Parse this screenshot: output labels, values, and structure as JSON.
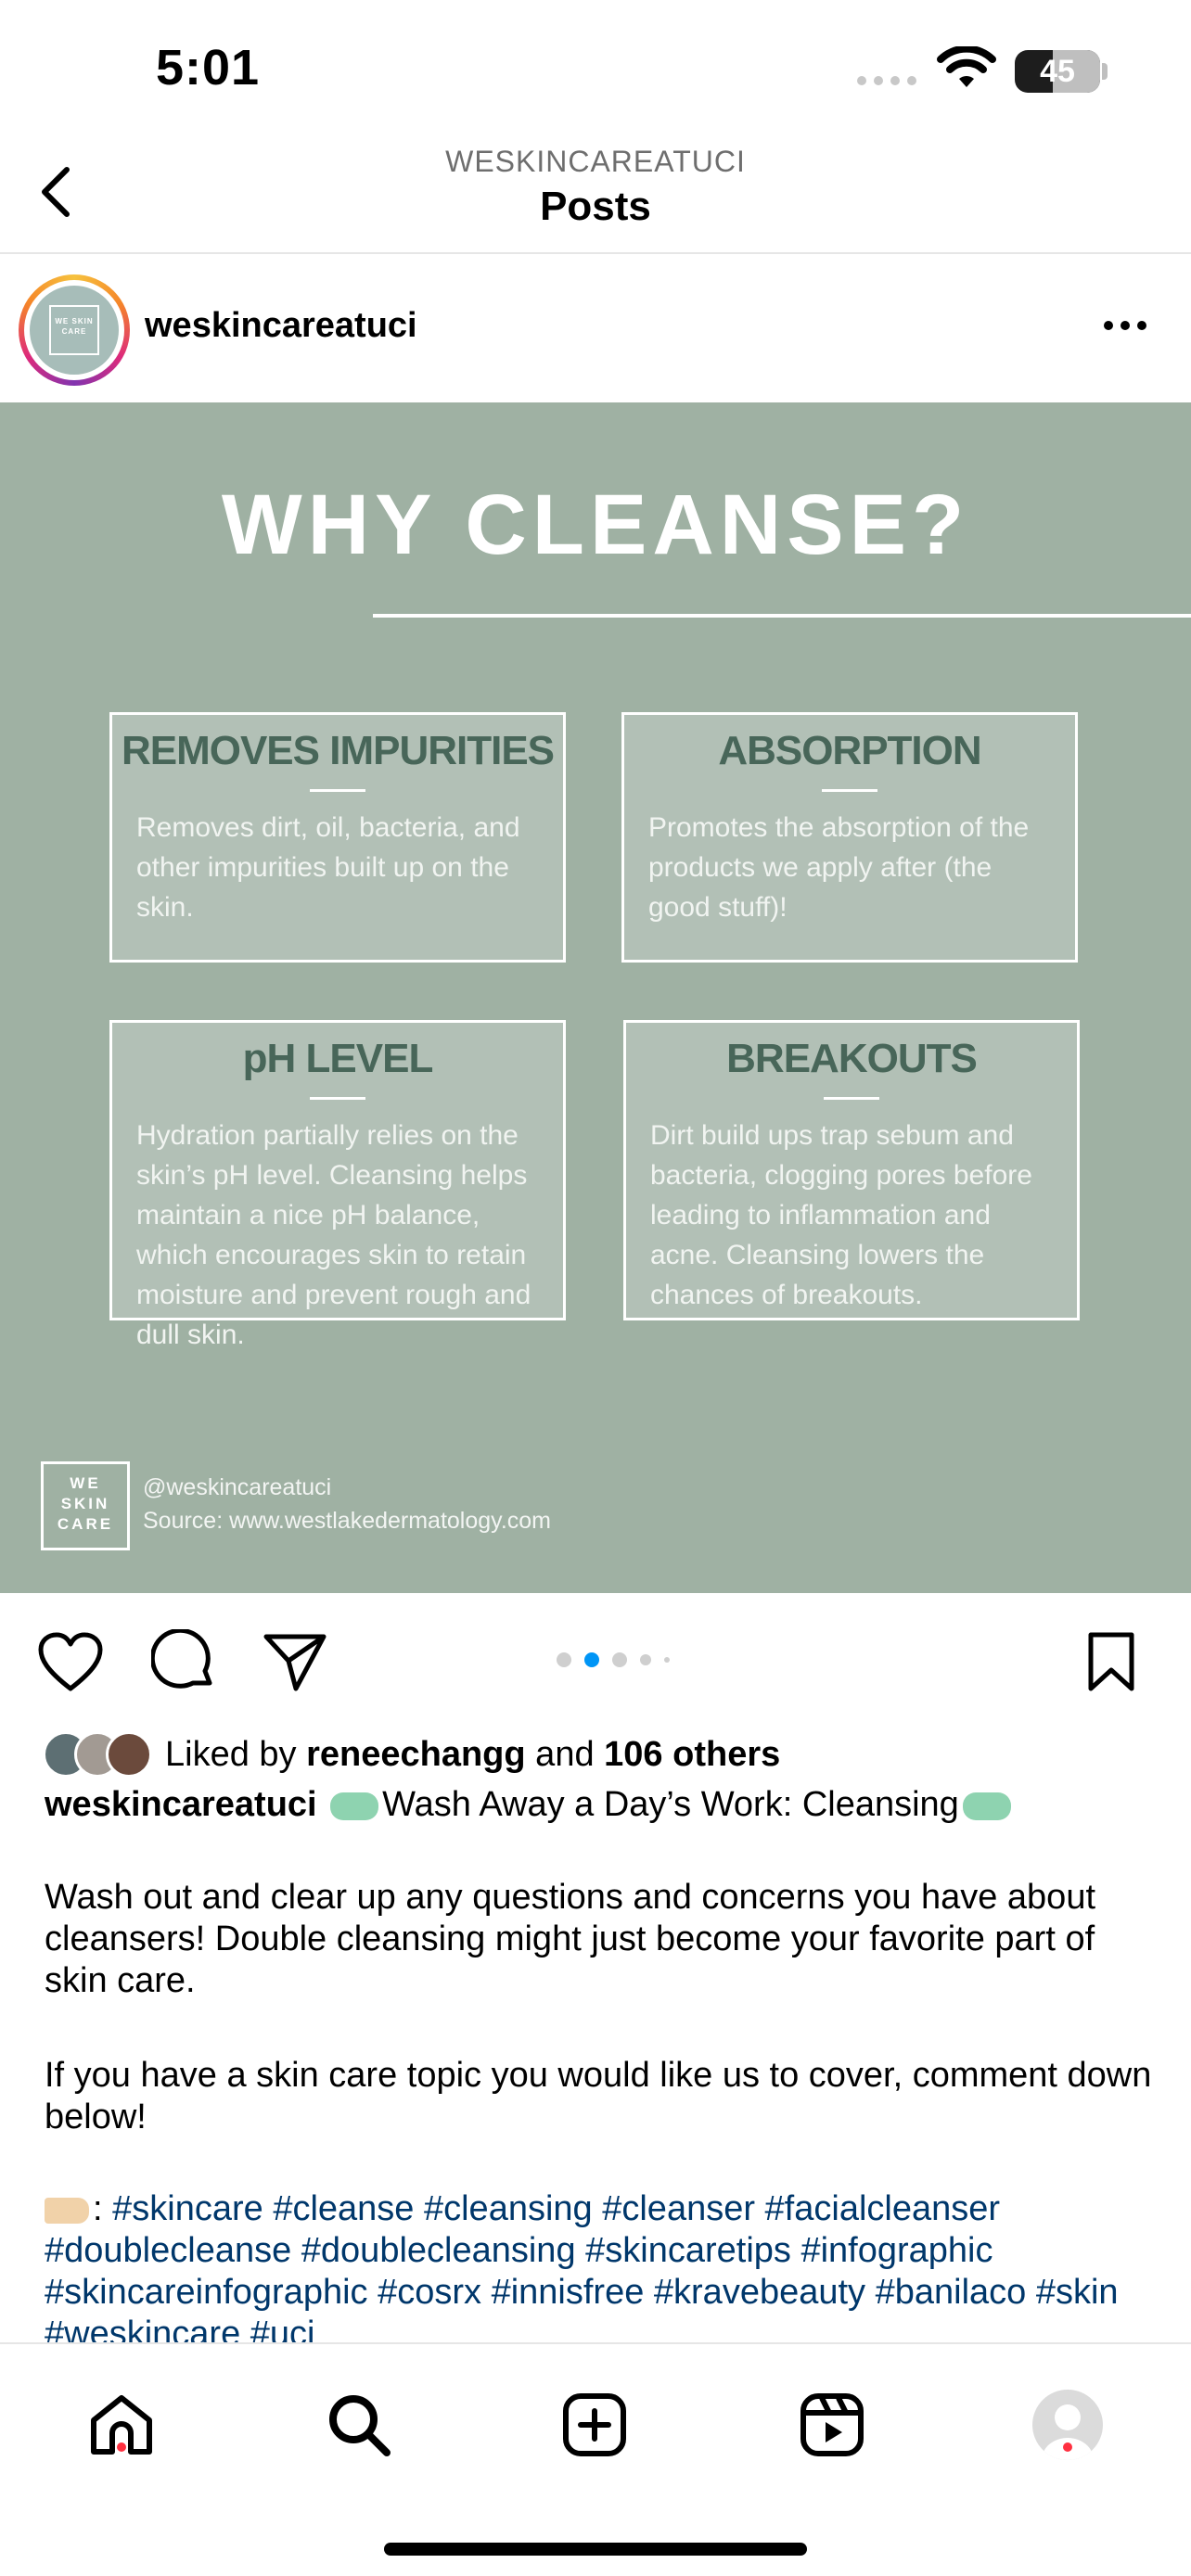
{
  "status_bar": {
    "time": "5:01",
    "battery": "45",
    "battery_level": 0.45
  },
  "nav": {
    "subtitle": "WESKINCAREATUCI",
    "title": "Posts"
  },
  "post": {
    "username": "weskincareatuci",
    "avatar_logo": "WE SKIN CARE"
  },
  "infographic": {
    "title": "WHY CLEANSE?",
    "cards": [
      {
        "heading": "REMOVES IMPURITIES",
        "body": "Removes dirt, oil, bacteria, and other impurities built up on the skin."
      },
      {
        "heading": "ABSORPTION",
        "body": "Promotes the absorption of the products we apply after (the good stuff)!"
      },
      {
        "heading": "pH LEVEL",
        "body": "Hydration partially relies on the skin’s pH level. Cleansing helps maintain a nice pH balance, which encourages skin to retain moisture and prevent rough and dull skin."
      },
      {
        "heading": "BREAKOUTS",
        "body": "Dirt build ups trap sebum and bacteria, clogging pores before leading to inflammation and acne. Cleansing lowers the chances of breakouts."
      }
    ],
    "footer_logo": [
      "WE",
      "SKIN",
      "CARE"
    ],
    "footer_handle": "@weskincareatuci",
    "footer_source": "Source: www.westlakedermatology.com"
  },
  "carousel": {
    "active_index": 1,
    "count": 5
  },
  "likes": {
    "prefix": "Liked by ",
    "user": "reneechangg",
    "middle": " and ",
    "others": "106 others"
  },
  "caption": {
    "username": "weskincareatuci",
    "headline": "Wash Away a Day’s Work: Cleansing",
    "paragraph1": "Wash out and clear up any questions and concerns you have about cleansers! Double cleansing might just become your favorite part of skin care.",
    "paragraph2": "If you have a skin care topic you would like us to cover, comment down below!",
    "tag_prefix": ": ",
    "hashtags": "#skincare #cleanse #cleansing #cleanser #facialcleanser #doublecleanse #doublecleansing #skincaretips #infographic #skincareinfographic #cosrx #innisfree #kravebeauty #banilaco #skin #weskincare #uci"
  },
  "icons": {
    "back": "chevron-left-icon",
    "more": "more-horizontal-icon",
    "like": "heart-icon",
    "comment": "comment-icon",
    "share": "send-icon",
    "save": "bookmark-icon",
    "home": "home-icon",
    "search": "search-icon",
    "create": "plus-square-icon",
    "reels": "reels-icon",
    "profile": "profile-icon"
  },
  "colors": {
    "infographic_bg": "#9fb1a3",
    "card_heading": "#486659",
    "carousel_active": "#0095f6",
    "notification_dot": "#ff3040",
    "hashtag": "#00376b"
  }
}
